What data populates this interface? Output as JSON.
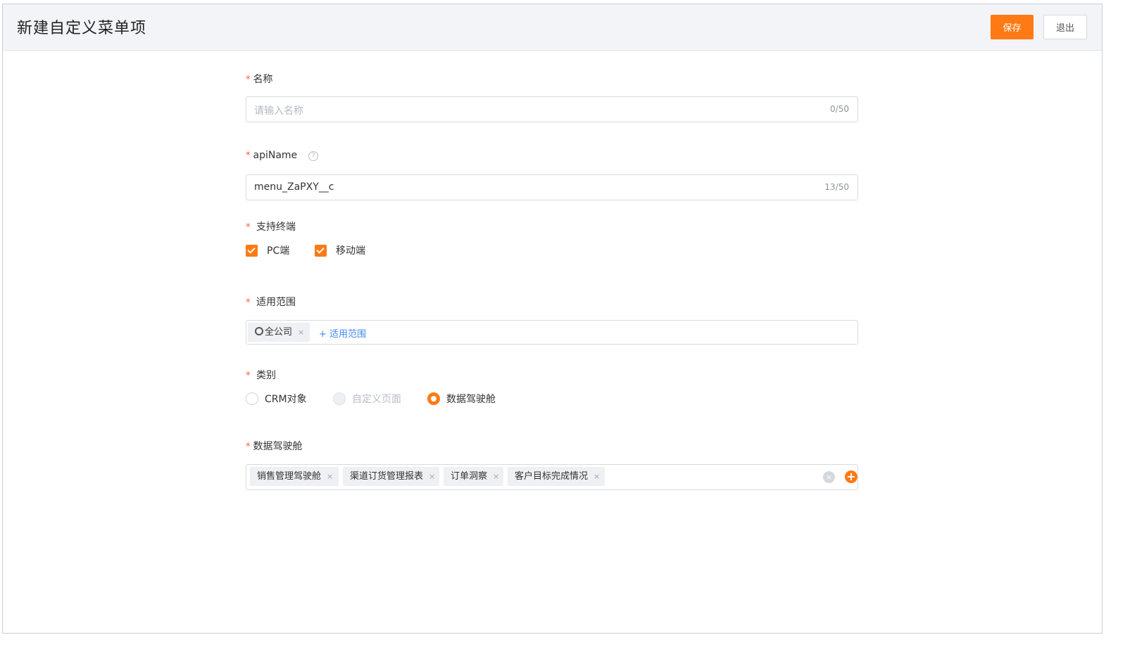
{
  "header": {
    "title": "新建自定义菜单项",
    "save_label": "保存",
    "exit_label": "退出"
  },
  "form": {
    "required_mark": "*",
    "name": {
      "label": "名称",
      "placeholder": "请输入名称",
      "count": "0/50"
    },
    "api_name": {
      "label": "apiName",
      "help_icon": "question-circle-icon",
      "value": "menu_ZaPXY__c",
      "count": "13/50"
    },
    "terminals": {
      "label": "支持终端",
      "options": [
        {
          "label": "PC端",
          "checked": true
        },
        {
          "label": "移动端",
          "checked": true
        }
      ]
    },
    "scope": {
      "label": "适用范围",
      "tags": [
        {
          "label": "全公司",
          "icon": "circle-icon",
          "remove": "×"
        }
      ],
      "add_label": "+ 适用范围"
    },
    "category": {
      "label": "类别",
      "options": [
        {
          "label": "CRM对象",
          "state": "unselected"
        },
        {
          "label": "自定义页面",
          "state": "disabled"
        },
        {
          "label": "数据驾驶舱",
          "state": "selected"
        }
      ]
    },
    "cockpit": {
      "label": "数据驾驶舱",
      "tags": [
        {
          "label": "销售管理驾驶舱",
          "remove": "×"
        },
        {
          "label": "渠道订货管理报表",
          "remove": "×"
        },
        {
          "label": "订单洞察",
          "remove": "×"
        },
        {
          "label": "客户目标完成情况",
          "remove": "×"
        }
      ],
      "clear_icon": "clear-circle-icon",
      "add_icon": "plus-circle-icon"
    }
  },
  "colors": {
    "accent": "#ff7a14",
    "link": "#3f88f0",
    "required": "#ff5a3c"
  }
}
